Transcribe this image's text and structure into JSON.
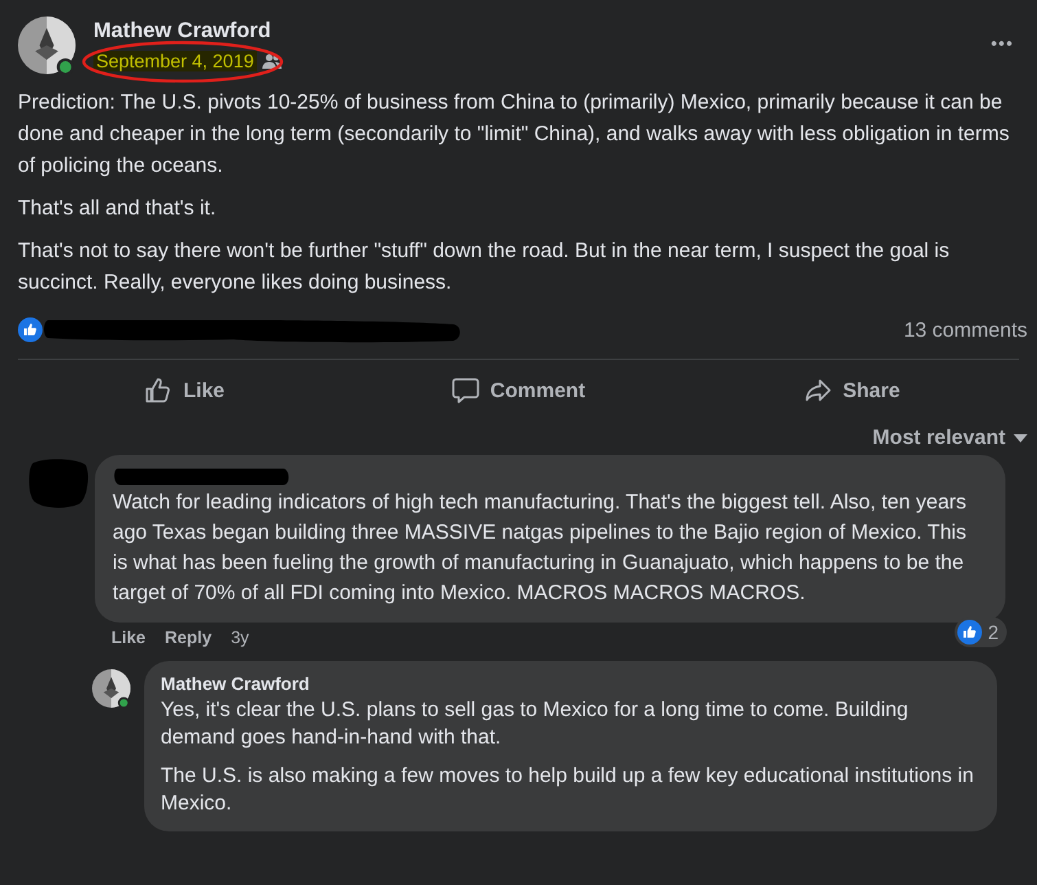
{
  "post": {
    "author": "Mathew Crawford",
    "date": "September 4, 2019",
    "date_annotated": true,
    "more": "•••",
    "paragraphs": [
      "Prediction: The U.S. pivots 10-25% of business from China to (primarily) Mexico, primarily because it can be done and cheaper in the long term (secondarily to \"limit\" China), and walks away with less obligation in terms of policing the oceans.",
      "That's all and that's it.",
      "That's not to say there won't be further \"stuff\" down the road. But in the near term, I suspect the goal is succinct. Really, everyone likes doing business."
    ],
    "reactors_redacted": true,
    "comments_count": "13 comments",
    "actions": [
      {
        "kind": "like",
        "label": "Like"
      },
      {
        "kind": "comment",
        "label": "Comment"
      },
      {
        "kind": "share",
        "label": "Share"
      }
    ],
    "sort": "Most relevant"
  },
  "comments": [
    {
      "author_redacted": true,
      "text": "Watch for leading indicators of high tech manufacturing. That's the biggest tell. Also, ten years ago Texas began building three MASSIVE natgas pipelines to the Bajio region of Mexico. This is what has been fueling the growth of manufacturing in Guanajuato, which happens to be the target of 70% of all FDI coming into Mexico. MACROS MACROS MACROS.",
      "actions": [
        "Like",
        "Reply"
      ],
      "time": "3y",
      "reaction_count": "2",
      "replies": [
        {
          "author": "Mathew Crawford",
          "online": true,
          "paragraphs": [
            "Yes, it's clear the U.S. plans to sell gas to Mexico for a long time to come. Building demand goes hand-in-hand with that.",
            "The U.S. is also making a few moves to help build up a few key educational institutions in Mexico."
          ]
        }
      ]
    }
  ]
}
